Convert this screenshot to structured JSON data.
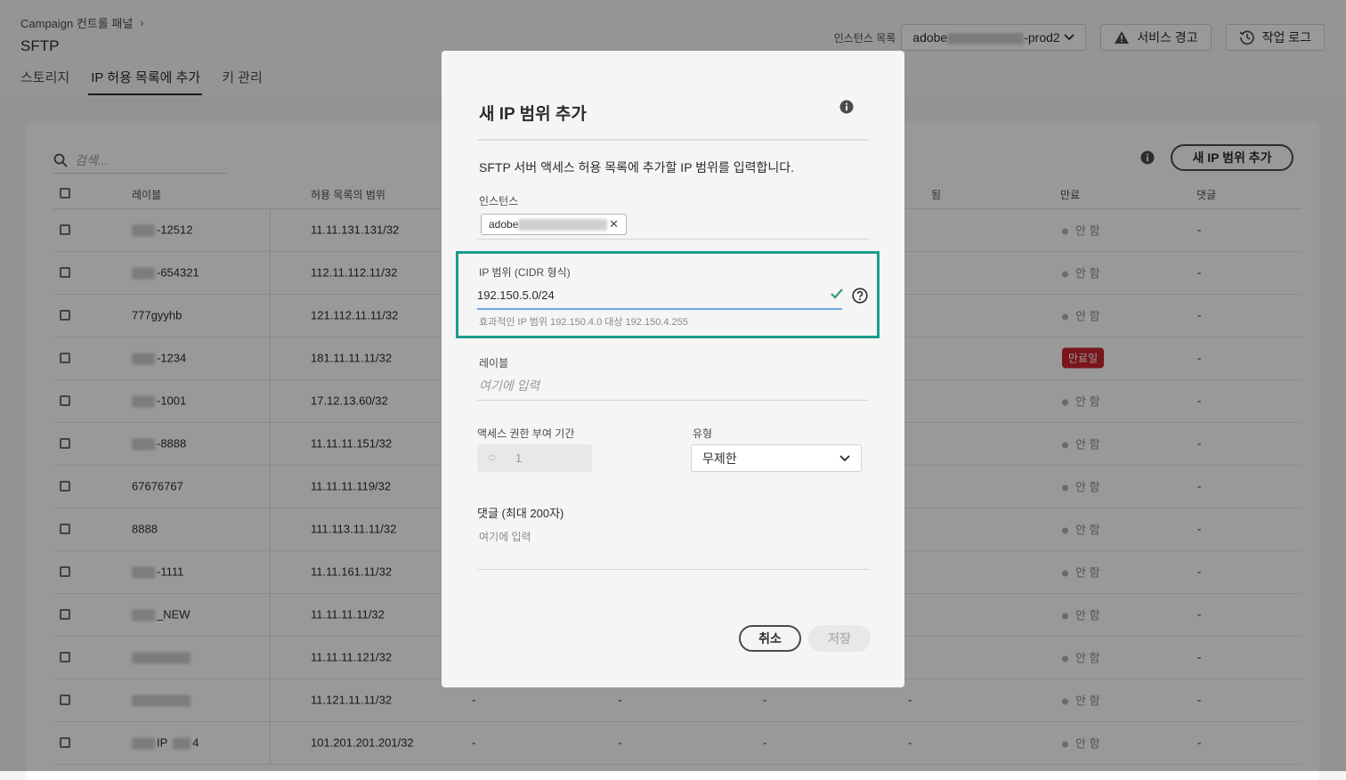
{
  "header": {
    "breadcrumb": "Campaign 컨트롤 패널",
    "title": "SFTP",
    "tabs": [
      {
        "label": "스토리지"
      },
      {
        "label": "IP 허용 목록에 추가"
      },
      {
        "label": "키 관리"
      }
    ],
    "instance_label": "인스턴스 목록",
    "instance_prefix": "adobe",
    "instance_suffix": "-prod2",
    "service_alert": "서비스 경고",
    "job_log": "작업 로그"
  },
  "list": {
    "search_placeholder": "검색...",
    "add_button": "새 IP 범위 추가",
    "columns": {
      "label": "레이블",
      "range": "허용 목록의 범위",
      "created": "됨",
      "expiry": "만료",
      "comment": "댓글"
    },
    "rows": [
      {
        "label": "-12512",
        "range": "11.11.131.131/32",
        "status": "안 함",
        "comment": "-"
      },
      {
        "label": "-654321",
        "range": "112.11.112.11/32",
        "status": "안 함",
        "comment": "-"
      },
      {
        "label": "777gyyhb",
        "range": "121.112.11.11/32",
        "status": "안 함",
        "comment": "-"
      },
      {
        "label": "-1234",
        "range": "181.11.11.11/32",
        "status": "만료일",
        "comment": "-"
      },
      {
        "label": "-1001",
        "range": "17.12.13.60/32",
        "status": "안 함",
        "comment": "-"
      },
      {
        "label": "-8888",
        "range": "11.11.11.151/32",
        "status": "안 함",
        "comment": "-"
      },
      {
        "label": "67676767",
        "range": "11.11.11.119/32",
        "status": "안 함",
        "comment": "-"
      },
      {
        "label": "8888",
        "range": "111.113.11.11/32",
        "status": "안 함",
        "comment": "-"
      },
      {
        "label": "-1111",
        "range": "11.11.161.11/32",
        "status": "안 함",
        "comment": "-"
      },
      {
        "label": "_NEW",
        "range": "11.11.11.11/32",
        "status": "안 함",
        "comment": "-"
      },
      {
        "label": "",
        "range": "11.11.11.121/32",
        "status": "안 함",
        "comment": "-"
      },
      {
        "label": "",
        "range": "11.121.11.11/32",
        "status": "안 함",
        "comment": "-",
        "dash": "-"
      },
      {
        "label": "IP",
        "label_suffix": "4",
        "range": "101.201.201.201/32",
        "status": "안 함",
        "comment": "-",
        "dash": "-"
      }
    ]
  },
  "dialog": {
    "title": "새 IP 범위 추가",
    "description": "SFTP 서버 액세스 허용 목록에 추가할 IP 범위를 입력합니다.",
    "instance_label": "인스턴스",
    "instance_tag": "adobe",
    "ip_label": "IP 범위 (CIDR 형식)",
    "ip_value": "192.150.5.0/24",
    "ip_help": "효과적인 IP 범위 192.150.4.0 대상 192.150.4.255",
    "label_label": "레이블",
    "label_placeholder": "여기에 입력",
    "duration_label": "액세스 권한 부여 기간",
    "duration_value": "1",
    "type_label": "유형",
    "type_value": "무제한",
    "comment_label": "댓글 (최대 200자)",
    "comment_placeholder": "여기에 입력",
    "cancel": "취소",
    "save": "저장"
  },
  "colors": {
    "highlight": "#1a9e8c",
    "expired": "#c9252d",
    "check": "#2d9d78",
    "input_focus": "#6aa7e6"
  }
}
